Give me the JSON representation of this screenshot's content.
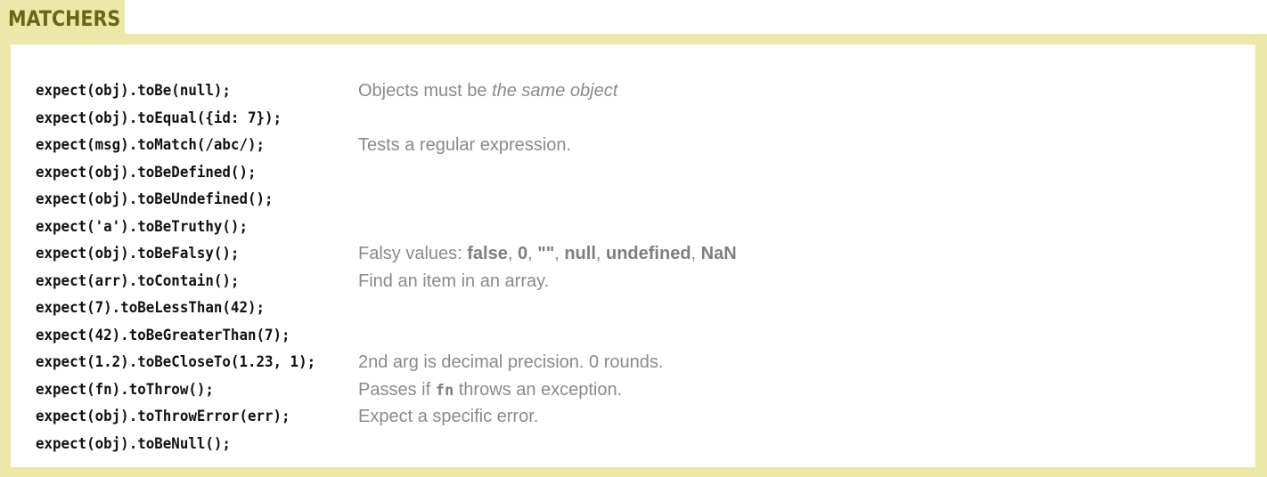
{
  "section": {
    "title": "MATCHERS"
  },
  "rows": [
    {
      "code": "expect(obj).toBe(null);",
      "desc": [
        {
          "text": "Objects must be ",
          "style": "plain"
        },
        {
          "text": "the same object",
          "style": "italic"
        }
      ]
    },
    {
      "code": "expect(obj).toEqual({id: 7});",
      "desc": []
    },
    {
      "code": "expect(msg).toMatch(/abc/);",
      "desc": [
        {
          "text": "Tests a regular expression.",
          "style": "plain"
        }
      ]
    },
    {
      "code": "expect(obj).toBeDefined();",
      "desc": []
    },
    {
      "code": "expect(obj).toBeUndefined();",
      "desc": []
    },
    {
      "code": "expect('a').toBeTruthy();",
      "desc": []
    },
    {
      "code": "expect(obj).toBeFalsy();",
      "desc": [
        {
          "text": "Falsy values: ",
          "style": "plain"
        },
        {
          "text": "false",
          "style": "bold"
        },
        {
          "text": ", ",
          "style": "plain"
        },
        {
          "text": "0",
          "style": "bold"
        },
        {
          "text": ", ",
          "style": "plain"
        },
        {
          "text": "\"\"",
          "style": "bold"
        },
        {
          "text": ", ",
          "style": "plain"
        },
        {
          "text": "null",
          "style": "bold"
        },
        {
          "text": ", ",
          "style": "plain"
        },
        {
          "text": "undefined",
          "style": "bold"
        },
        {
          "text": ", ",
          "style": "plain"
        },
        {
          "text": "NaN",
          "style": "bold"
        }
      ]
    },
    {
      "code": "expect(arr).toContain();",
      "desc": [
        {
          "text": "Find an item in an array.",
          "style": "plain"
        }
      ]
    },
    {
      "code": "expect(7).toBeLessThan(42);",
      "desc": []
    },
    {
      "code": "expect(42).toBeGreaterThan(7);",
      "desc": []
    },
    {
      "code": "expect(1.2).toBeCloseTo(1.23, 1);",
      "desc": [
        {
          "text": "2nd arg is decimal precision. 0 rounds.",
          "style": "plain"
        }
      ]
    },
    {
      "code": "expect(fn).toThrow();",
      "desc": [
        {
          "text": "Passes if ",
          "style": "plain"
        },
        {
          "text": "fn",
          "style": "mono"
        },
        {
          "text": " throws an exception.",
          "style": "plain"
        }
      ]
    },
    {
      "code": "expect(obj).toThrowError(err);",
      "desc": [
        {
          "text": "Expect a specific error.",
          "style": "plain"
        }
      ]
    },
    {
      "code": "expect(obj).toBeNull();",
      "desc": []
    }
  ],
  "colors": {
    "tab_background": "#ebe8a9",
    "tab_text": "#686814",
    "code_text": "#111111",
    "description_text": "#8a8a8a"
  }
}
